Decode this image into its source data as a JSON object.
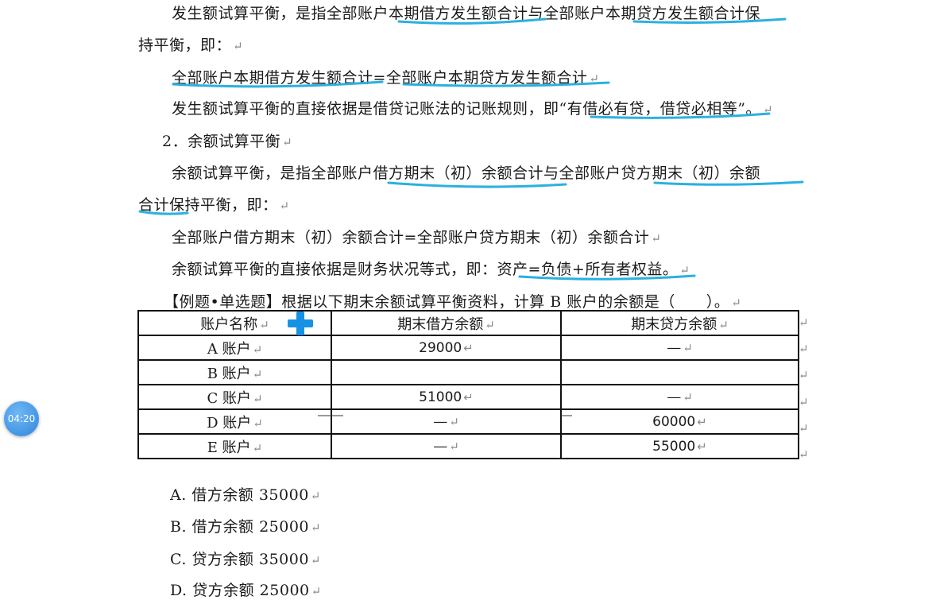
{
  "paragraphs": {
    "p1a": "发生额试算平衡，是指全部账户本期借方发生额合计与全部账户本期贷方发生额合计保",
    "p1b": "持平衡，即：",
    "p2": "全部账户本期借方发生额合计=全部账户本期贷方发生额合计",
    "p3": "发生额试算平衡的直接依据是借贷记账法的记账规则，即“有借必有贷，借贷必相等”。",
    "h2": "2．余额试算平衡",
    "p4a": "余额试算平衡，是指全部账户借方期末（初）余额合计与全部账户贷方期末（初）余额",
    "p4b": "合计保持平衡，即：",
    "p5": "全部账户借方期末（初）余额合计=全部账户贷方期末（初）余额合计",
    "p6": "余额试算平衡的直接依据是财务状况等式，即：资产=负债+所有者权益。",
    "question": "【例题•单选题】根据以下期末余额试算平衡资料，计算 B 账户的余额是（　　）。"
  },
  "return_mark": "↵",
  "table": {
    "headers": [
      "账户名称",
      "期末借方余额",
      "期末贷方余额"
    ],
    "rows": [
      {
        "name": "A 账户",
        "debit": "29000",
        "credit": "—"
      },
      {
        "name": "B 账户",
        "debit": "",
        "credit": ""
      },
      {
        "name": "C 账户",
        "debit": "51000",
        "credit": "—"
      },
      {
        "name": "D 账户",
        "debit": "—",
        "credit": "60000"
      },
      {
        "name": "E 账户",
        "debit": "—",
        "credit": "55000"
      }
    ]
  },
  "options": [
    "A. 借方余额 35000",
    "B. 借方余额 25000",
    "C. 贷方余额 35000",
    "D. 贷方余额 25000"
  ],
  "timer": "04:20",
  "colors": {
    "annotation": "#2bb0e0",
    "cursor": "#1592e6",
    "timer": "#3a93e6"
  }
}
